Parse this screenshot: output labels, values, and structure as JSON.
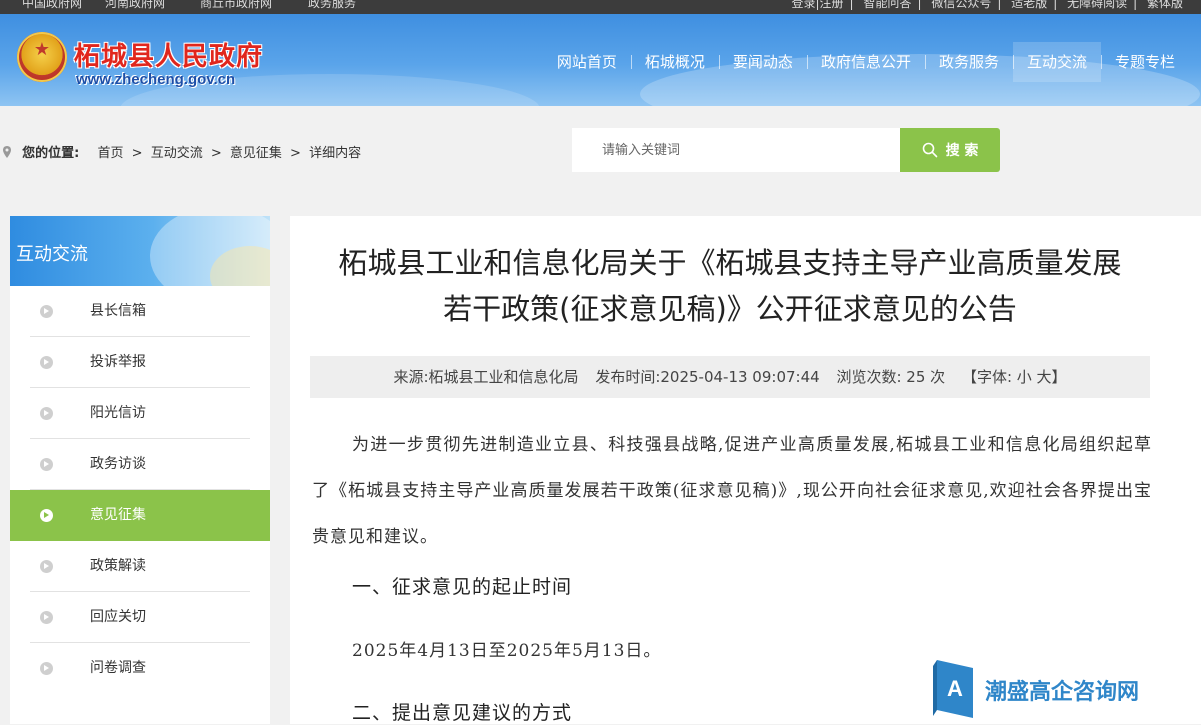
{
  "topbar": {
    "left_links": [
      "中国政府网",
      "河南政府网",
      "商丘市政府网",
      "政务服务"
    ],
    "right_links": [
      "登录|注册",
      "智能问答",
      "微信公众号",
      "适老版",
      "无障碍阅读",
      "繁体版"
    ]
  },
  "header": {
    "site_title": "柘城县人民政府",
    "site_url": "www.zhecheng.gov.cn",
    "nav": [
      "网站首页",
      "柘城概况",
      "要闻动态",
      "政府信息公开",
      "政务服务",
      "互动交流",
      "专题专栏"
    ],
    "active_nav": "互动交流"
  },
  "breadcrumb": {
    "label": "您的位置:",
    "items": [
      "首页",
      "互动交流",
      "意见征集",
      "详细内容"
    ]
  },
  "search": {
    "placeholder": "请输入关键词",
    "button": "搜 索"
  },
  "sidebar": {
    "title": "互动交流",
    "items": [
      "县长信箱",
      "投诉举报",
      "阳光信访",
      "政务访谈",
      "意见征集",
      "政策解读",
      "回应关切",
      "问卷调查"
    ],
    "active": "意见征集"
  },
  "article": {
    "title": "柘城县工业和信息化局关于《柘城县支持主导产业高质量发展若干政策(征求意见稿)》公开征求意见的公告",
    "meta": {
      "source": "来源:柘城县工业和信息化局",
      "time": "发布时间:2025-04-13 09:07:44",
      "views": "浏览次数: 25 次",
      "font": "【字体: 小 大】"
    },
    "intro": "为进一步贯彻先进制造业立县、科技强县战略,促进产业高质量发展,柘城县工业和信息化局组织起草了《柘城县支持主导产业高质量发展若干政策(征求意见稿)》,现公开向社会征求意见,欢迎社会各界提出宝贵意见和建议。",
    "section1": "一、征求意见的起止时间",
    "section1_text": "2025年4月13日至2025年5月13日。",
    "section2": "二、提出意见建议的方式"
  },
  "watermark": {
    "text": "潮盛高企咨询网"
  },
  "colors": {
    "accent_green": "#8bc34a",
    "header_blue": "#4a97e4",
    "topbar": "#3c3c3c"
  }
}
